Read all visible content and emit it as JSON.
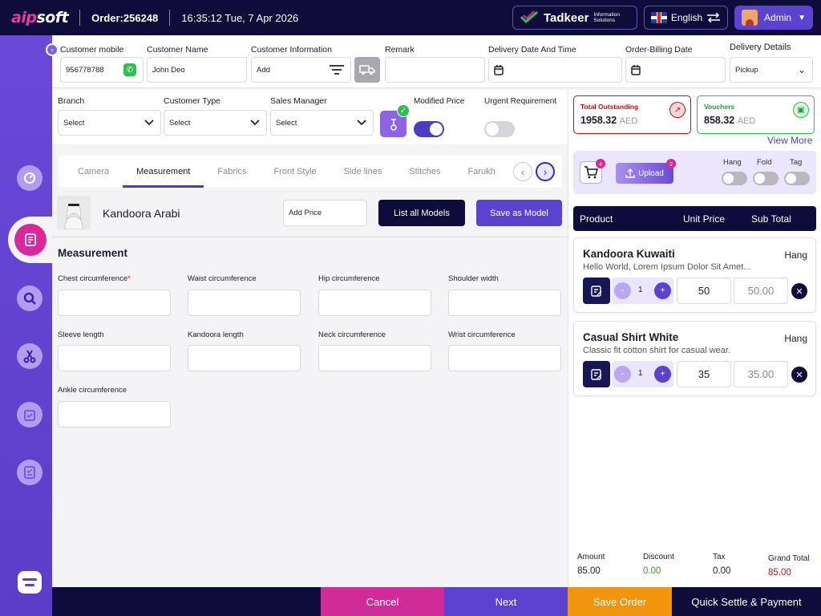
{
  "header": {
    "logo_a": "aip",
    "logo_b": "soft",
    "order_label": "Order:",
    "order_no": "256248",
    "datetime": "16:35:12 Tue, 7 Apr 2026",
    "tadkeer_name": "Tadkeer",
    "tadkeer_sub1": "Information",
    "tadkeer_sub2": "Solutions",
    "language": "English",
    "user": "Admin"
  },
  "form1": {
    "mobile_label": "Customer mobile",
    "mobile_value": "956778788",
    "name_label": "Customer Name",
    "name_value": "John Deo",
    "info_label": "Customer Information",
    "info_value": "Add",
    "remark_label": "Remark",
    "delivery_dt_label": "Delivery Date And Time",
    "billing_label": "Order-Billing Date",
    "delivery_details_label": "Delivery Details",
    "delivery_details_value": "Pickup"
  },
  "form2": {
    "branch_label": "Branch",
    "branch_value": "Select",
    "ctype_label": "Customer Type",
    "ctype_value": "Select",
    "manager_label": "Sales Manager",
    "manager_value": "Select",
    "modified_label": "Modified Price",
    "modified_on": true,
    "urgent_label": "Urgent Requirement",
    "urgent_on": false
  },
  "tabs": [
    "Camera",
    "Measurement",
    "Fabrics",
    "Front Style",
    "Side lines",
    "Stitches",
    "Farukh"
  ],
  "active_tab": "Measurement",
  "model": {
    "name": "Kandoora Arabi",
    "add_price_placeholder": "Add Price",
    "list_models": "List all Models",
    "save_model": "Save as Model"
  },
  "measurement": {
    "title": "Measurement",
    "fields": [
      {
        "label": "Chest circumference",
        "required": "*"
      },
      {
        "label": "Waist circumference"
      },
      {
        "label": "Hip circumference"
      },
      {
        "label": "Shoulder width"
      },
      {
        "label": "Sleeve length"
      },
      {
        "label": "Kandoora length"
      },
      {
        "label": "Neck circumference"
      },
      {
        "label": "Wrist circumference"
      },
      {
        "label": "Ankle circumference"
      }
    ]
  },
  "right": {
    "outstanding_label": "Total Outstanding",
    "outstanding_value": "1958.32",
    "vouchers_label": "Vouchers",
    "vouchers_value": "858.32",
    "currency": "AED",
    "view_more": "View More",
    "cart_count": "4",
    "upload_label": "Upload",
    "upload_count": "2",
    "hang_label": "Hang",
    "fold_label": "Fold",
    "tag_label": "Tag",
    "col_product": "Product",
    "col_unit": "Unit Price",
    "col_sub": "Sub Total",
    "items": [
      {
        "name": "Kandoora Kuwaiti",
        "desc": "Hello World, Lorem Ipsum Dolor Sit Amet...",
        "type": "Hang",
        "qty": "1",
        "unit": "50",
        "sub": "50.00"
      },
      {
        "name": "Casual Shirt White",
        "desc": "Classic fit cotton shirt for casual wear.",
        "type": "Hang",
        "qty": "1",
        "unit": "35",
        "sub": "35.00"
      }
    ],
    "totals": {
      "amount_label": "Amount",
      "amount": "85.00",
      "discount_label": "Discount",
      "discount": "0.00",
      "tax_label": "Tax",
      "tax": "0.00",
      "grand_label": "Grand Total",
      "grand": "85.00"
    }
  },
  "footer": {
    "cancel": "Cancel",
    "next": "Next",
    "save_order": "Save Order",
    "settle": "Quick Settle & Payment"
  },
  "colors": {
    "navy": "#0f0b3a",
    "purple": "#5b43d0",
    "pink": "#d9289c",
    "orange": "#f0950d",
    "green": "#2dbf4f",
    "red": "#c0101a"
  }
}
